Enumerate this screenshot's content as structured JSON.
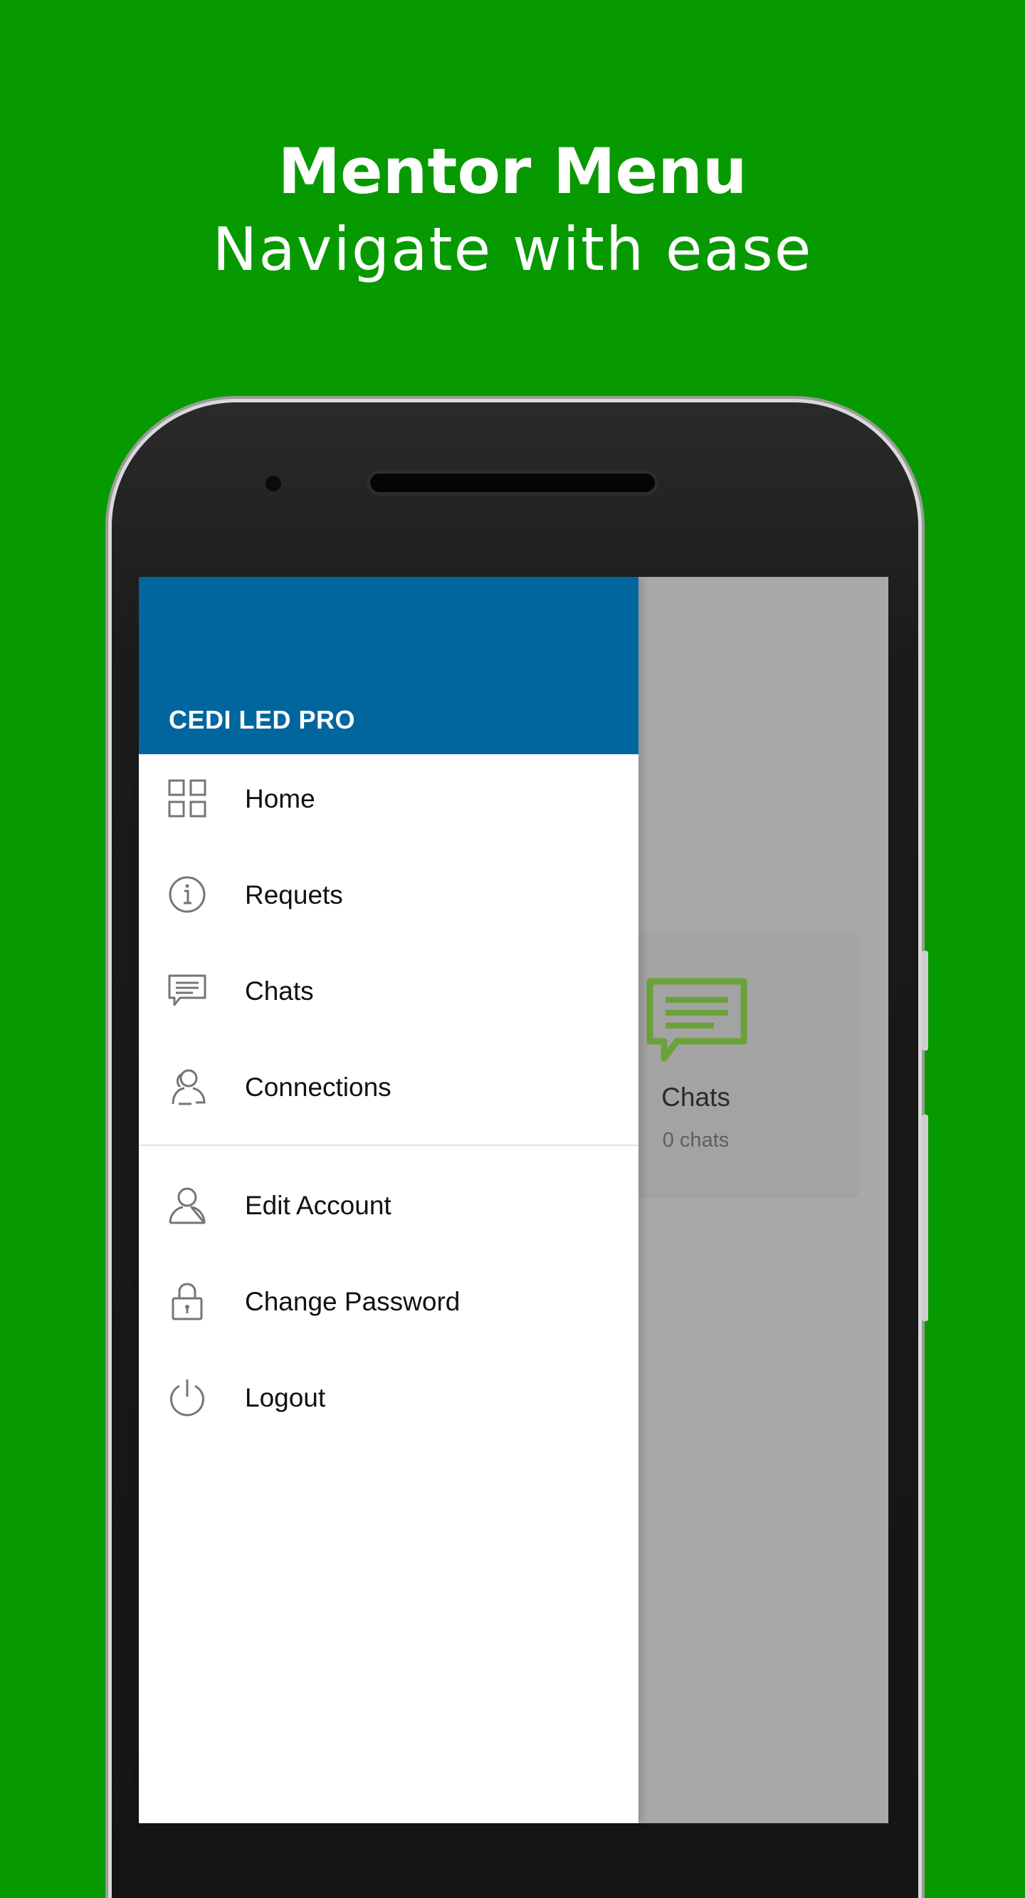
{
  "headline": {
    "title": "Mentor Menu",
    "subtitle": "Navigate with ease"
  },
  "background_screen": {
    "card_title": "Chats",
    "card_subtitle": "0 chats",
    "card_icon": "chat-bubble-icon",
    "accent_color": "#6aa239"
  },
  "drawer": {
    "header_title": "CEDI LED PRO",
    "header_color": "#02669e",
    "items": [
      {
        "label": "Home",
        "icon": "grid-icon"
      },
      {
        "label": "Requets",
        "icon": "info-icon"
      },
      {
        "label": "Chats",
        "icon": "chat-icon"
      },
      {
        "label": "Connections",
        "icon": "users-icon"
      },
      {
        "label": "Edit Account",
        "icon": "user-icon"
      },
      {
        "label": "Change Password",
        "icon": "lock-icon"
      },
      {
        "label": "Logout",
        "icon": "power-icon"
      }
    ]
  },
  "colors": {
    "background": "#079a00",
    "scrim": "#a9a9a9"
  }
}
